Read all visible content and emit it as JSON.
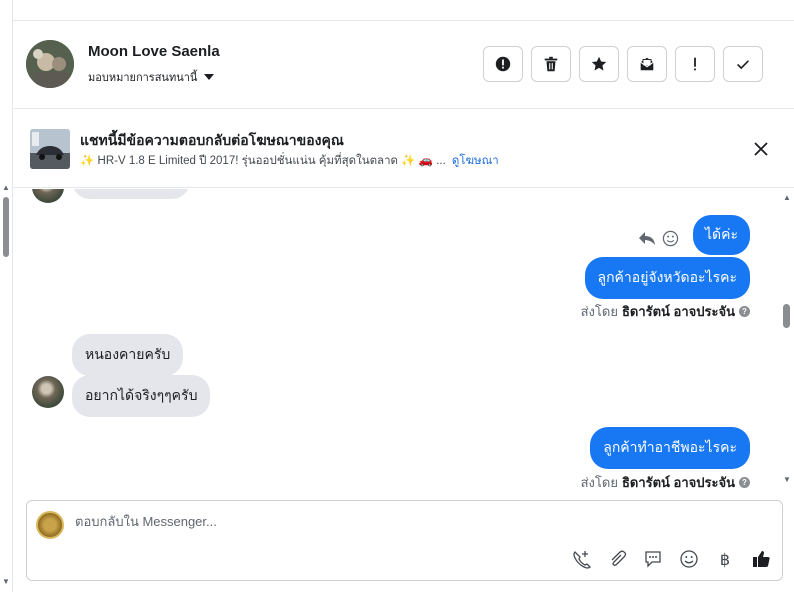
{
  "header": {
    "name": "Moon Love Saenla",
    "assign_label": "มอบหมายการสนทนานี้"
  },
  "actions": [
    {
      "icon": "alert-circle-icon",
      "name": "mark-spam-button"
    },
    {
      "icon": "trash-icon",
      "name": "delete-button"
    },
    {
      "icon": "star-icon",
      "name": "star-button"
    },
    {
      "icon": "mail-unread-icon",
      "name": "mark-unread-button"
    },
    {
      "icon": "exclamation-icon",
      "name": "follow-up-button"
    },
    {
      "icon": "check-icon",
      "name": "done-button"
    }
  ],
  "ad": {
    "title": "แชทนี้มีข้อความตอบกลับต่อโฆษณาของคุณ",
    "description": "✨ HR-V 1.8 E Limited ปี 2017! รุ่นออปชั่นแน่น คุ้มที่สุดในตลาด ✨ 🚗 ...",
    "link": "ดูโฆษณา"
  },
  "messages": {
    "out_1": "ได้ค่ะ",
    "out_2": "ลูกค้าอยู่จังหวัดอะไรคะ",
    "sent_by_prefix": "ส่งโดย",
    "sent_by_name": "ธิดารัตน์ อาจประจัน",
    "in_1": "หนองคายครับ",
    "in_2": "อยากได้จริงๆๆครับ",
    "out_3": "ลูกค้าทำอาชีพอะไรคะ"
  },
  "composer": {
    "placeholder": "ตอบกลับใน Messenger...",
    "tools": [
      "call-add-icon",
      "paperclip-icon",
      "chat-bubble-icon",
      "emoji-icon",
      "baht-icon",
      "thumbs-up-icon"
    ],
    "baht_symbol": "฿"
  },
  "colors": {
    "accent": "#1877f2",
    "incoming_bubble": "#e4e6eb",
    "link": "#216fdb"
  }
}
